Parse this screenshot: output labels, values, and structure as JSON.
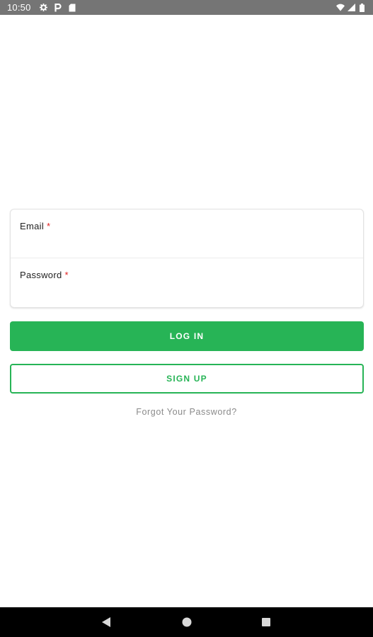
{
  "status_bar": {
    "time": "10:50",
    "left_icons": [
      "gear-icon",
      "parking-p-icon",
      "sd-card-icon"
    ],
    "right_icons": [
      "wifi-icon",
      "cell-signal-icon",
      "battery-icon"
    ]
  },
  "form": {
    "email": {
      "label": "Email",
      "required_mark": "*",
      "value": ""
    },
    "password": {
      "label": "Password",
      "required_mark": "*",
      "value": ""
    }
  },
  "buttons": {
    "login": "LOG IN",
    "signup": "SIGN UP"
  },
  "links": {
    "forgot_password": "Forgot Your Password?"
  },
  "nav_bar": {
    "icons": [
      "back-triangle-icon",
      "home-circle-icon",
      "recents-square-icon"
    ]
  },
  "colors": {
    "accent": "#27b456",
    "status_bar_bg": "#757575",
    "nav_bar_bg": "#000000",
    "required": "#e01f1f",
    "link_text": "#8a8a8a"
  }
}
